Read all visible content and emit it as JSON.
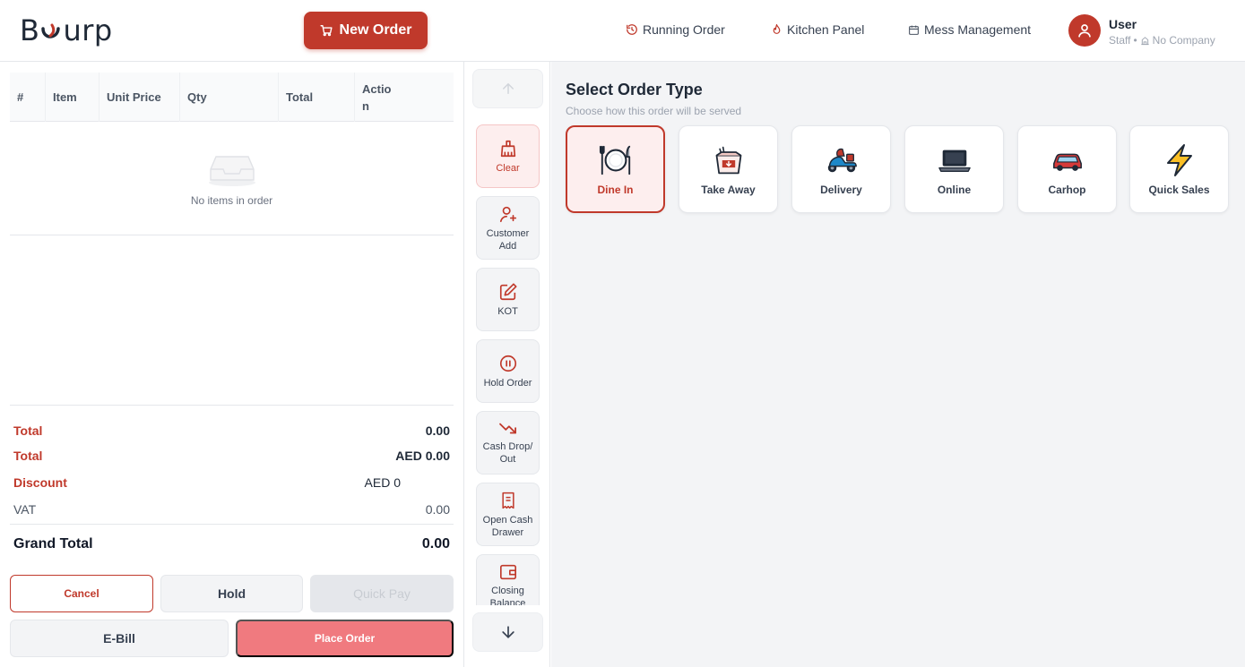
{
  "header": {
    "logo_text": "B",
    "logo_text_end": "urp",
    "new_order_label": "New Order",
    "nav": [
      {
        "label": "Running Order",
        "icon": "history-icon"
      },
      {
        "label": "Kitchen Panel",
        "icon": "flame-icon"
      },
      {
        "label": "Mess Management",
        "icon": "calendar-icon"
      }
    ],
    "user": {
      "name": "User",
      "role": "Staff",
      "separator": "•",
      "company": "No Company"
    }
  },
  "order_table": {
    "columns": [
      "#",
      "Item",
      "Unit Price",
      "Qty",
      "Total",
      "Actio\nn"
    ],
    "empty_text": "No items in order"
  },
  "totals": {
    "rows": [
      {
        "label": "Total",
        "value": "0.00"
      },
      {
        "label": "Total",
        "value": "AED 0.00"
      },
      {
        "label": "Discount",
        "value": "AED 0"
      },
      {
        "label": "VAT",
        "value": "0.00"
      }
    ],
    "grand_total_label": "Grand Total",
    "grand_total_value": "0.00"
  },
  "buttons": {
    "cancel": "Cancel",
    "hold": "Hold",
    "quick_pay": "Quick Pay",
    "ebill": "E-Bill",
    "place_order": "Place Order"
  },
  "actions": [
    {
      "label": "Clear",
      "icon": "broom-icon"
    },
    {
      "label": "Customer Add",
      "icon": "user-plus-icon"
    },
    {
      "label": "KOT",
      "icon": "edit-icon"
    },
    {
      "label": "Hold Order",
      "icon": "pause-icon"
    },
    {
      "label": "Cash Drop/ Out",
      "icon": "trending-down-icon"
    },
    {
      "label": "Open Cash Drawer",
      "icon": "receipt-icon"
    },
    {
      "label": "Closing Balance",
      "icon": "wallet-icon"
    }
  ],
  "order_type": {
    "title": "Select Order Type",
    "subtitle": "Choose how this order will be served",
    "selected": "Dine In",
    "types": [
      {
        "label": "Dine In",
        "icon": "plate-cutlery-icon"
      },
      {
        "label": "Take Away",
        "icon": "takeout-box-icon"
      },
      {
        "label": "Delivery",
        "icon": "scooter-icon"
      },
      {
        "label": "Online",
        "icon": "laptop-icon"
      },
      {
        "label": "Carhop",
        "icon": "car-icon"
      },
      {
        "label": "Quick Sales",
        "icon": "lightning-icon"
      }
    ]
  },
  "colors": {
    "brand": "#c0392b",
    "place_order": "#f07a7f",
    "panel_bg": "#f3f4f6"
  }
}
